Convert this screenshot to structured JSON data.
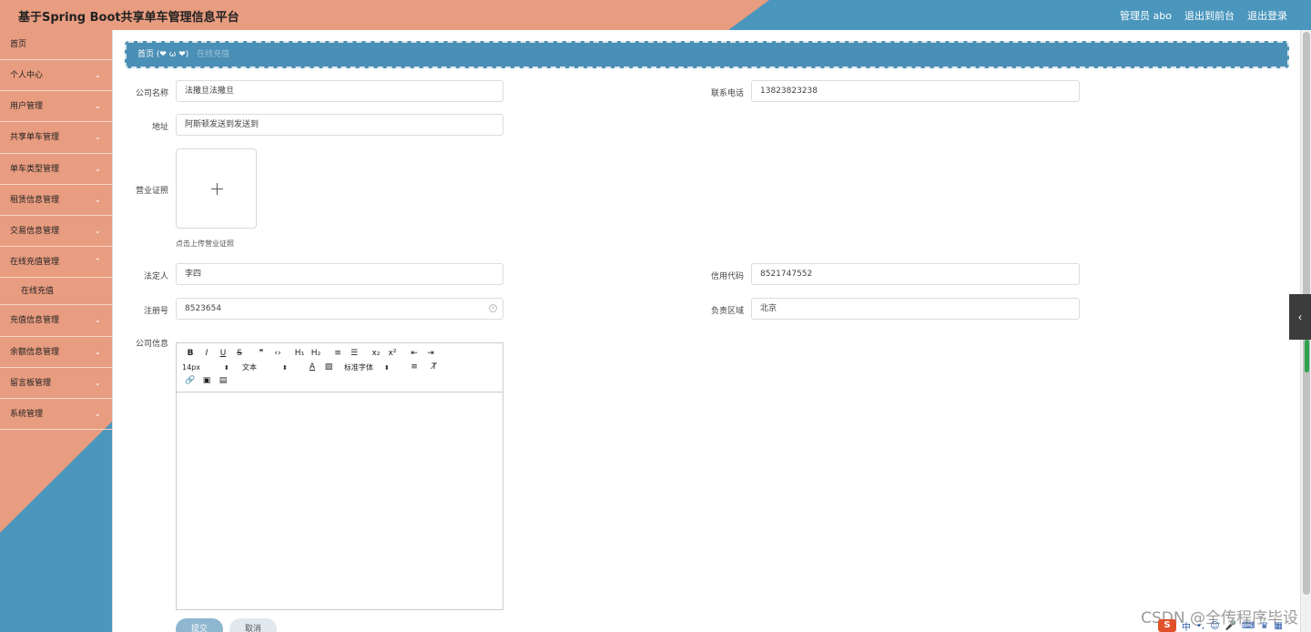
{
  "header": {
    "title": "基于Spring Boot共享单车管理信息平台",
    "links": [
      "管理员 abo",
      "退出到前台",
      "退出登录"
    ]
  },
  "sidebar": {
    "items": [
      {
        "label": "首页"
      },
      {
        "label": "个人中心"
      },
      {
        "label": "用户管理"
      },
      {
        "label": "共享单车管理"
      },
      {
        "label": "单车类型管理"
      },
      {
        "label": "租赁信息管理"
      },
      {
        "label": "交易信息管理"
      },
      {
        "label": "在线充值管理",
        "expanded": true,
        "children": [
          "在线充值"
        ]
      },
      {
        "label": "充值信息管理"
      },
      {
        "label": "余额信息管理"
      },
      {
        "label": "留言板管理"
      },
      {
        "label": "系统管理"
      }
    ]
  },
  "breadcrumb": {
    "home": "首页",
    "emoticon": "(❤ ω ❤)",
    "current": "在线充值"
  },
  "form": {
    "company_name_label": "公司名称",
    "company_name_value": "法撒旦法撒旦",
    "phone_label": "联系电话",
    "phone_value": "13823823238",
    "address_label": "地址",
    "address_value": "阿斯顿发送到发送到",
    "license_label": "营业证照",
    "license_hint": "点击上传营业证照",
    "legal_person_label": "法定人",
    "legal_person_value": "李四",
    "credit_code_label": "信用代码",
    "credit_code_value": "8521747552",
    "reg_no_label": "注册号",
    "reg_no_value": "8523654",
    "region_label": "负责区域",
    "region_value": "北京",
    "company_info_label": "公司信息"
  },
  "editor": {
    "row1": [
      "B",
      "I",
      "U",
      "S",
      "❞",
      "‹›",
      "H₁",
      "H₂",
      "≡",
      "☰",
      "x₂",
      "x²",
      "⇤",
      "⇥"
    ],
    "font_size": "14px",
    "text_type": "文本",
    "font_family": "标准字体",
    "row3": [
      "🔗",
      "▣",
      "▤"
    ]
  },
  "buttons": {
    "submit": "提交",
    "cancel": "取消"
  },
  "watermark": "CSDN @全传程序毕设",
  "ime": {
    "logo": "S",
    "lang": "中"
  },
  "colors": {
    "salmon": "#e89c80",
    "blue": "#4a96bd"
  }
}
